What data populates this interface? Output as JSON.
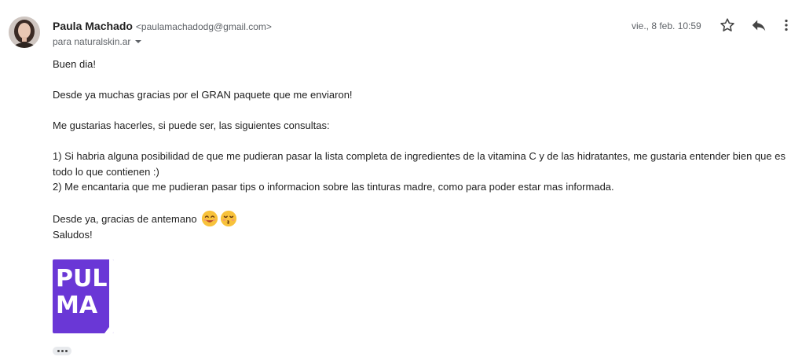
{
  "sender": {
    "name": "Paula Machado",
    "email": "<paulamachadodg@gmail.com>"
  },
  "recipient": {
    "text": "para naturalskin.ar"
  },
  "date": "vie., 8 feb. 10:59",
  "icons": {
    "star": "star-icon",
    "reply": "reply-icon",
    "more": "more-vert-icon",
    "emoji1": "smiling-face-icon",
    "emoji2": "kissing-face-icon"
  },
  "body": {
    "greeting": "Buen dia!",
    "thanks": "Desde ya muchas gracias por el GRAN paquete que me enviaron!",
    "intro": "Me gustarias hacerles, si puede ser, las siguientes consultas:",
    "q1_line1": "1)  Si habria alguna posibilidad de que me pudieran pasar la lista completa de ingredientes de la vitamina C y de las hidratantes,  me gustaria entender bien que es",
    "q1_line2": "todo lo que contienen :)",
    "q2": "2)  Me encantaria que me pudieran pasar tips o informacion sobre las tinturas madre, como para poder estar mas informada.",
    "closing": "Desde ya, gracias de antemano",
    "signoff": "Saludos!"
  },
  "logo": {
    "line1": "PULI",
    "line2": "MA",
    "color": "#6a37d6"
  }
}
